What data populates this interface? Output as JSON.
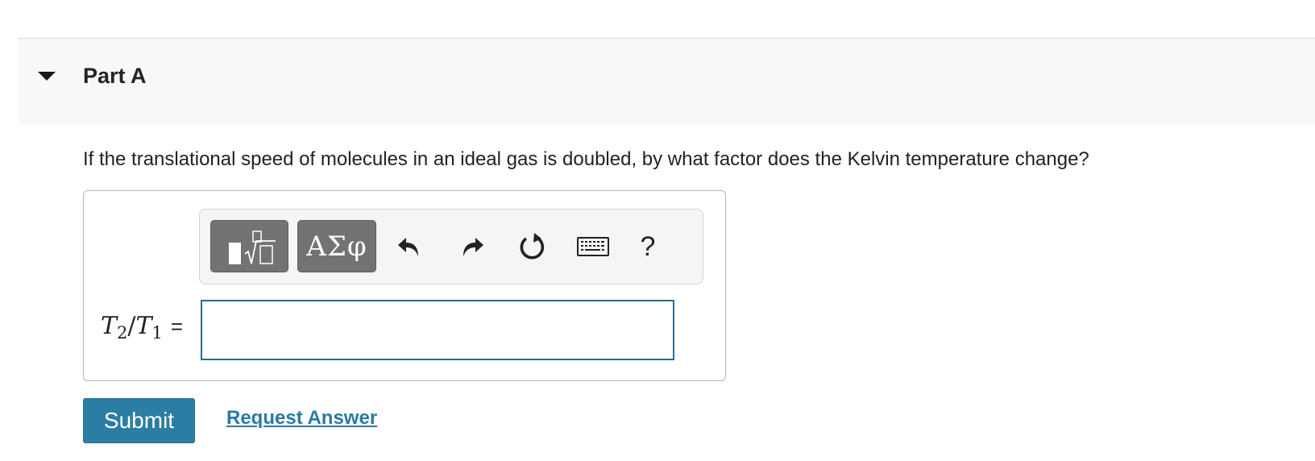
{
  "part": {
    "title": "Part A",
    "caret_icon": "caret-down-icon"
  },
  "question": {
    "text": "If the translational speed of molecules in an ideal gas is doubled, by what factor does the Kelvin temperature change?"
  },
  "toolbar": {
    "templates_icon": "templates-radical-icon",
    "symbols_label": "ΑΣφ",
    "undo_icon": "undo-icon",
    "redo_icon": "redo-icon",
    "reset_icon": "reset-icon",
    "keyboard_icon": "keyboard-icon",
    "help_label": "?"
  },
  "answer": {
    "variable": {
      "t2": "T",
      "t2_sub": "2",
      "slash": "/",
      "t1": "T",
      "t1_sub": "1",
      "equals": "="
    },
    "input_value": ""
  },
  "actions": {
    "submit_label": "Submit",
    "request_answer_label": "Request Answer"
  },
  "colors": {
    "submit_bg": "#2c7da3",
    "link": "#2a7aa5",
    "input_border": "#2a6b92",
    "toolbar_button": "#737373"
  }
}
